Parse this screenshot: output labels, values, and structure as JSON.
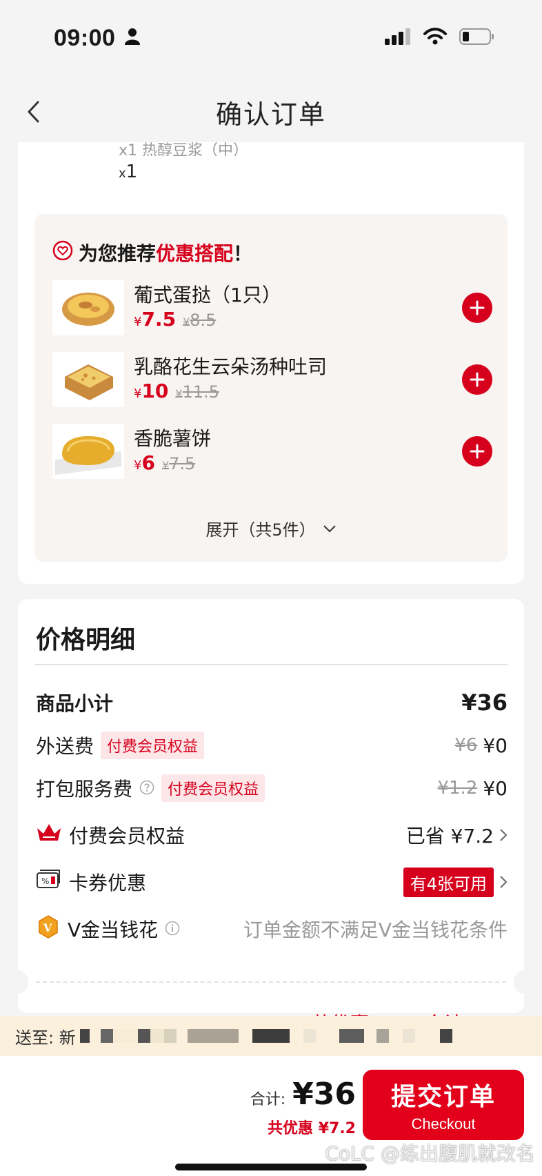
{
  "status_bar": {
    "time": "09:00"
  },
  "nav": {
    "title": "确认订单"
  },
  "order_item": {
    "cut_off_text": "x1 热醇豆浆（中）",
    "qty_prefix": "x",
    "qty": "1"
  },
  "recommend": {
    "head_prefix": "为您推荐",
    "head_highlight": "优惠搭配",
    "head_suffix": "！",
    "items": [
      {
        "name": "葡式蛋挞（1只）",
        "price": "7.5",
        "old_price": "8.5",
        "yen": "¥"
      },
      {
        "name": "乳酪花生云朵汤种吐司",
        "price": "10",
        "old_price": "11.5",
        "yen": "¥"
      },
      {
        "name": "香脆薯饼",
        "price": "6",
        "old_price": "7.5",
        "yen": "¥"
      }
    ],
    "expand_label": "展开（共5件）"
  },
  "price_details": {
    "title": "价格明细",
    "subtotal_label": "商品小计",
    "subtotal_value": "¥36",
    "delivery_label": "外送费",
    "delivery_tag": "付费会员权益",
    "delivery_old": "¥6",
    "delivery_value": "¥0",
    "packing_label": "打包服务费",
    "packing_tag": "付费会员权益",
    "packing_old": "¥1.2",
    "packing_value": "¥0",
    "member_label": "付费会员权益",
    "member_value": "已省 ¥7.2",
    "coupon_label": "卡券优惠",
    "coupon_value": "有4张可用",
    "vgold_label": "V金当钱花",
    "vgold_value": "订单金额不满足V金当钱花条件",
    "partial_total": "共优惠 ¥7.2  合计 ¥36"
  },
  "address": {
    "prefix": "送至: 新"
  },
  "bottom": {
    "total_label": "合计:",
    "total_amount": "¥36",
    "saved": "共优惠 ¥7.2",
    "checkout_cn": "提交订单",
    "checkout_en": "Checkout",
    "watermark": "CoLC @练出腹肌就改名"
  },
  "colors": {
    "accent": "#d6001c",
    "button": "#e2001a",
    "address_strip": "#fbf0dc"
  }
}
